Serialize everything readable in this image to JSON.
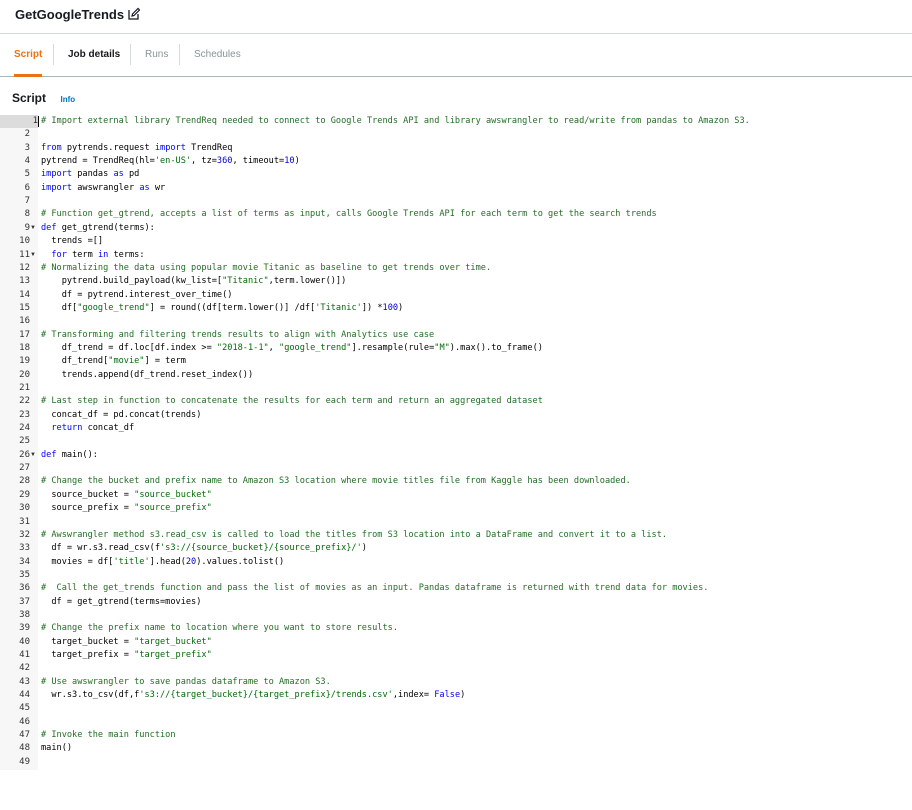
{
  "header": {
    "job_title": "GetGoogleTrends",
    "edit_icon": "edit-icon"
  },
  "tabs": [
    {
      "label": "Script",
      "state": "active"
    },
    {
      "label": "Job details",
      "state": "normal"
    },
    {
      "label": "Runs",
      "state": "muted"
    },
    {
      "label": "Schedules",
      "state": "muted"
    }
  ],
  "section": {
    "title": "Script",
    "info_label": "Info"
  },
  "editor": {
    "current_line": 1,
    "fold_lines": [
      9,
      11,
      26
    ],
    "lines": [
      [
        [
          "c",
          "# Import external library TrendReq needed to connect to Google Trends API and library awswrangler to read/write from pandas to Amazon S3."
        ]
      ],
      [],
      [
        [
          "k",
          "from"
        ],
        [
          "t",
          " pytrends.request "
        ],
        [
          "k",
          "import"
        ],
        [
          "t",
          " TrendReq"
        ]
      ],
      [
        [
          "t",
          "pytrend = TrendReq(hl="
        ],
        [
          "s",
          "'en-US'"
        ],
        [
          "t",
          ", tz="
        ],
        [
          "n",
          "360"
        ],
        [
          "t",
          ", timeout="
        ],
        [
          "n",
          "10"
        ],
        [
          "t",
          ")"
        ]
      ],
      [
        [
          "k",
          "import"
        ],
        [
          "t",
          " pandas "
        ],
        [
          "k",
          "as"
        ],
        [
          "t",
          " pd"
        ]
      ],
      [
        [
          "k",
          "import"
        ],
        [
          "t",
          " awswrangler "
        ],
        [
          "k",
          "as"
        ],
        [
          "t",
          " wr"
        ]
      ],
      [],
      [
        [
          "c",
          "# Function get_gtrend, accepts a list of terms as input, calls Google Trends API for each term to get the search trends"
        ]
      ],
      [
        [
          "k",
          "def"
        ],
        [
          "t",
          " get_gtrend(terms):"
        ]
      ],
      [
        [
          "t",
          "  trends =[]"
        ]
      ],
      [
        [
          "t",
          "  "
        ],
        [
          "k",
          "for"
        ],
        [
          "t",
          " term "
        ],
        [
          "k",
          "in"
        ],
        [
          "t",
          " terms:"
        ]
      ],
      [
        [
          "c",
          "# Normalizing the data using popular movie Titanic as baseline to get trends over time."
        ]
      ],
      [
        [
          "t",
          "    pytrend.build_payload(kw_list=["
        ],
        [
          "s",
          "\"Titanic\""
        ],
        [
          "t",
          ",term.lower()])"
        ]
      ],
      [
        [
          "t",
          "    df = pytrend.interest_over_time()"
        ]
      ],
      [
        [
          "t",
          "    df["
        ],
        [
          "s",
          "\"google_trend\""
        ],
        [
          "t",
          "] = round((df[term.lower()] /df["
        ],
        [
          "s",
          "'Titanic'"
        ],
        [
          "t",
          "]) *"
        ],
        [
          "n",
          "100"
        ],
        [
          "t",
          ")"
        ]
      ],
      [],
      [
        [
          "c",
          "# Transforming and filtering trends results to align with Analytics use case"
        ]
      ],
      [
        [
          "t",
          "    df_trend = df.loc[df.index >= "
        ],
        [
          "s",
          "\"2018-1-1\""
        ],
        [
          "t",
          ", "
        ],
        [
          "s",
          "\"google_trend\""
        ],
        [
          "t",
          "].resample(rule="
        ],
        [
          "s",
          "\"M\""
        ],
        [
          "t",
          ").max().to_frame()"
        ]
      ],
      [
        [
          "t",
          "    df_trend["
        ],
        [
          "s",
          "\"movie\""
        ],
        [
          "t",
          "] = term"
        ]
      ],
      [
        [
          "t",
          "    trends.append(df_trend.reset_index())"
        ]
      ],
      [],
      [
        [
          "c",
          "# Last step in function to concatenate the results for each term and return an aggregated dataset"
        ]
      ],
      [
        [
          "t",
          "  concat_df = pd.concat(trends)"
        ]
      ],
      [
        [
          "t",
          "  "
        ],
        [
          "k",
          "return"
        ],
        [
          "t",
          " concat_df"
        ]
      ],
      [],
      [
        [
          "k",
          "def"
        ],
        [
          "t",
          " main():"
        ]
      ],
      [],
      [
        [
          "c",
          "# Change the bucket and prefix name to Amazon S3 location where movie titles file from Kaggle has been downloaded."
        ]
      ],
      [
        [
          "t",
          "  source_bucket = "
        ],
        [
          "s",
          "\"source_bucket\""
        ]
      ],
      [
        [
          "t",
          "  source_prefix = "
        ],
        [
          "s",
          "\"source_prefix\""
        ]
      ],
      [],
      [
        [
          "c",
          "# Awswrangler method s3.read_csv is called to load the titles from S3 location into a DataFrame and convert it to a list."
        ]
      ],
      [
        [
          "t",
          "  df = wr.s3.read_csv(f"
        ],
        [
          "s",
          "'s3://{source_bucket}/{source_prefix}/'"
        ],
        [
          "t",
          ")"
        ]
      ],
      [
        [
          "t",
          "  movies = df["
        ],
        [
          "s",
          "'title'"
        ],
        [
          "t",
          "].head("
        ],
        [
          "n",
          "20"
        ],
        [
          "t",
          ").values.tolist()"
        ]
      ],
      [],
      [
        [
          "c",
          "#  Call the get_trends function and pass the list of movies as an input. Pandas dataframe is returned with trend data for movies."
        ]
      ],
      [
        [
          "t",
          "  df = get_gtrend(terms=movies)"
        ]
      ],
      [],
      [
        [
          "c",
          "# Change the prefix name to location where you want to store results."
        ]
      ],
      [
        [
          "t",
          "  target_bucket = "
        ],
        [
          "s",
          "\"target_bucket\""
        ]
      ],
      [
        [
          "t",
          "  target_prefix = "
        ],
        [
          "s",
          "\"target_prefix\""
        ]
      ],
      [],
      [
        [
          "c",
          "# Use awswrangler to save pandas dataframe to Amazon S3."
        ]
      ],
      [
        [
          "t",
          "  wr.s3.to_csv(df,f"
        ],
        [
          "s",
          "'s3://{target_bucket}/{target_prefix}/trends.csv'"
        ],
        [
          "t",
          ",index= "
        ],
        [
          "k",
          "False"
        ],
        [
          "t",
          ")"
        ]
      ],
      [],
      [],
      [
        [
          "c",
          "# Invoke the main function"
        ]
      ],
      [
        [
          "t",
          "main()"
        ]
      ],
      []
    ]
  }
}
